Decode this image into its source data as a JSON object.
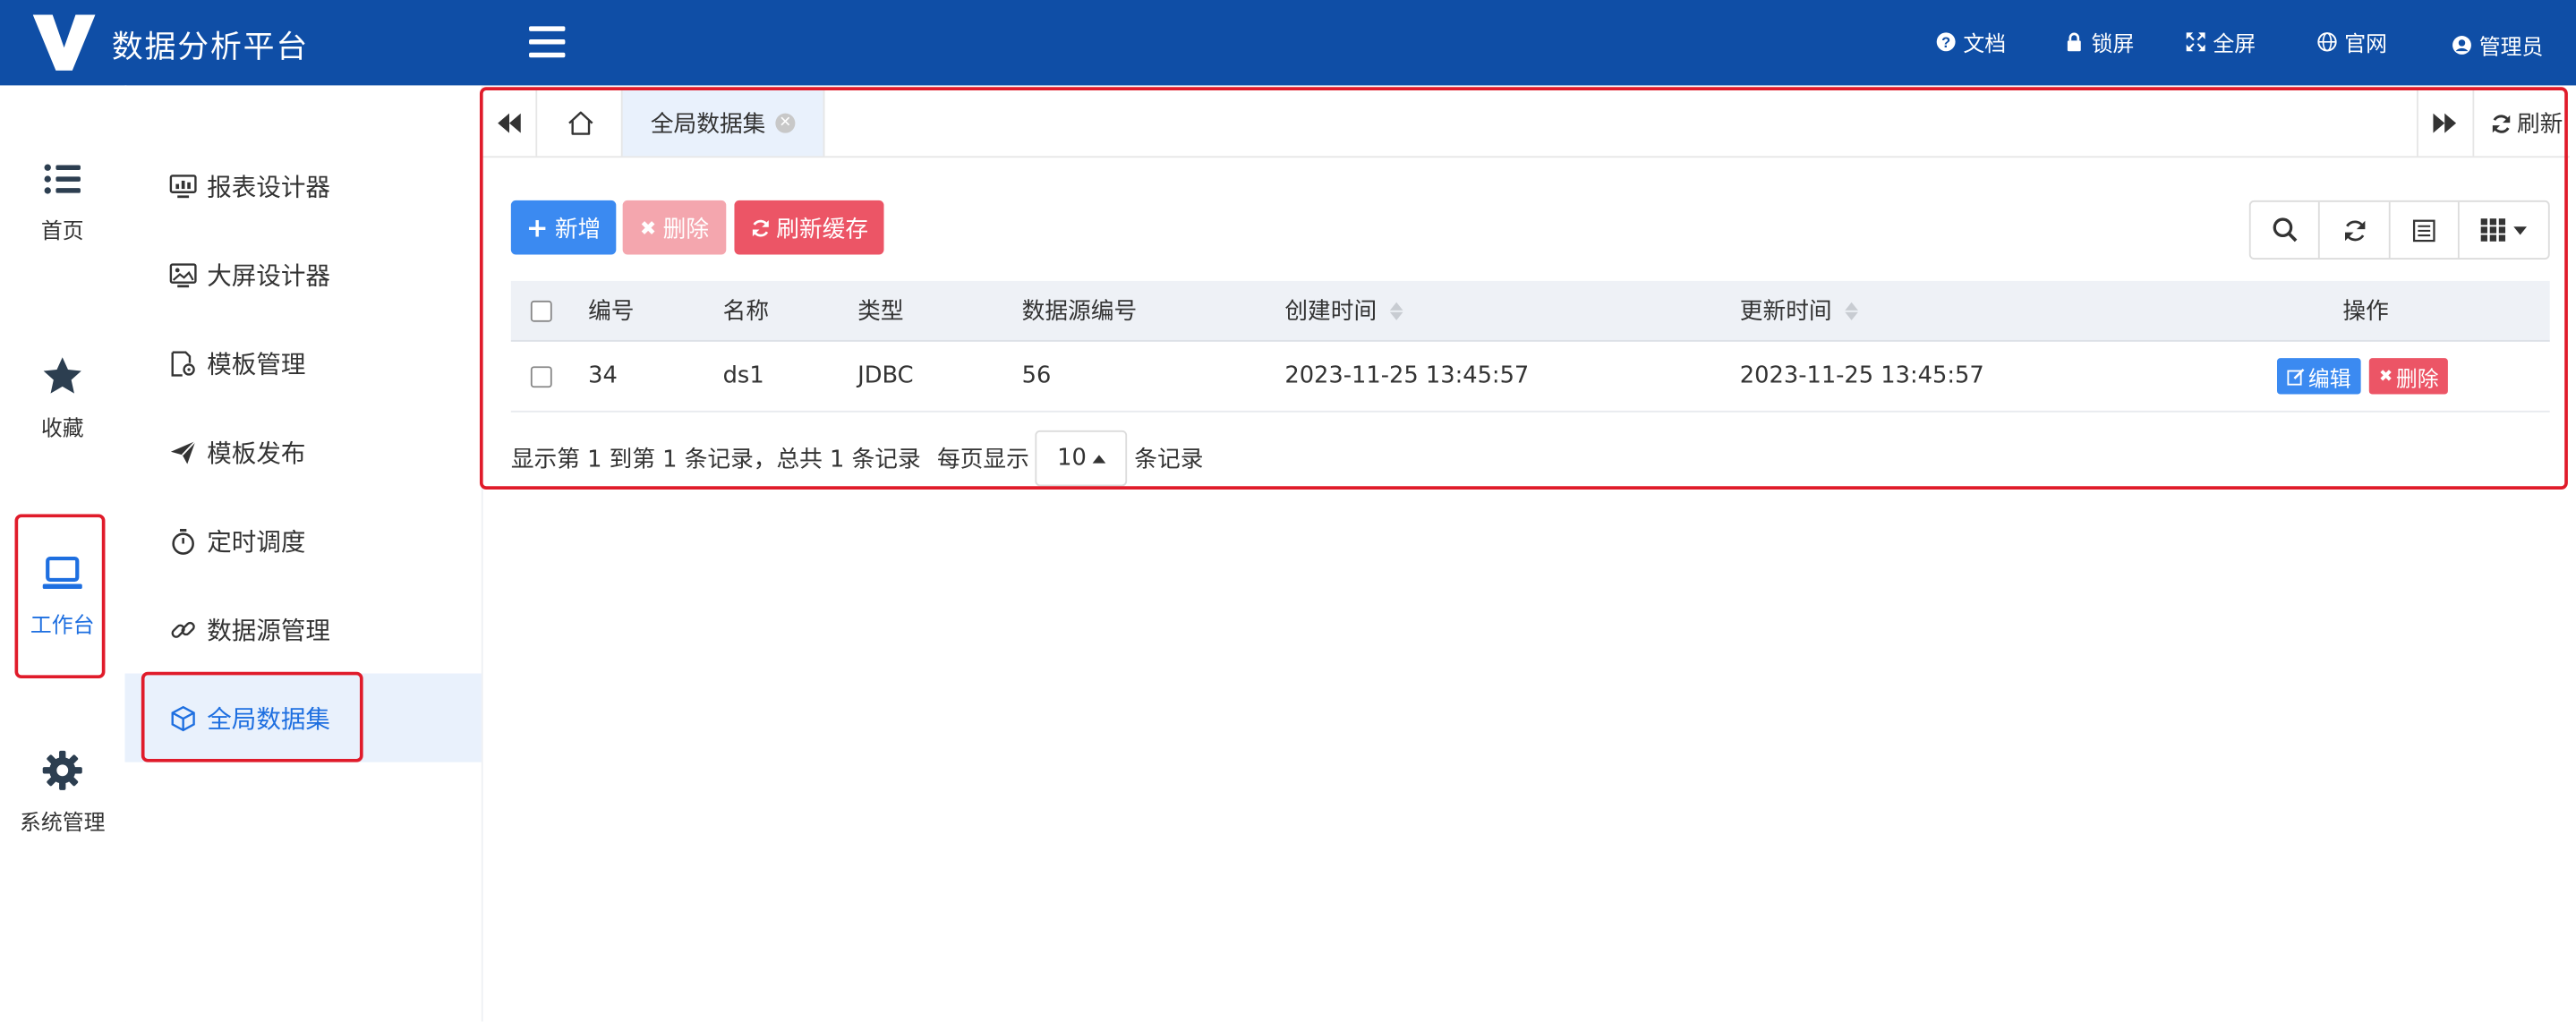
{
  "header": {
    "app_title": "数据分析平台",
    "links": [
      {
        "label": "文档",
        "icon": "question-circle-icon"
      },
      {
        "label": "锁屏",
        "icon": "lock-icon"
      },
      {
        "label": "全屏",
        "icon": "expand-icon"
      },
      {
        "label": "官网",
        "icon": "globe-icon"
      },
      {
        "label": "管理员",
        "icon": "user-circle-icon"
      }
    ],
    "brand_color": "#0f4ea6"
  },
  "rail": {
    "items": [
      {
        "label": "首页",
        "icon": "list-icon"
      },
      {
        "label": "收藏",
        "icon": "star-icon"
      },
      {
        "label": "工作台",
        "icon": "laptop-icon",
        "active": true
      },
      {
        "label": "系统管理",
        "icon": "gear-icon"
      }
    ]
  },
  "submenu": {
    "items": [
      {
        "label": "报表设计器",
        "icon": "monitor-chart-icon"
      },
      {
        "label": "大屏设计器",
        "icon": "screen-image-icon"
      },
      {
        "label": "模板管理",
        "icon": "template-settings-icon"
      },
      {
        "label": "模板发布",
        "icon": "send-icon"
      },
      {
        "label": "定时调度",
        "icon": "stopwatch-icon"
      },
      {
        "label": "数据源管理",
        "icon": "link-icon"
      },
      {
        "label": "全局数据集",
        "icon": "cube-icon",
        "active": true
      }
    ]
  },
  "tabs": {
    "active_label": "全局数据集",
    "refresh_label": "刷新"
  },
  "toolbar": {
    "add_label": "新增",
    "delete_label": "删除",
    "refresh_cache_label": "刷新缓存"
  },
  "table": {
    "columns": [
      "编号",
      "名称",
      "类型",
      "数据源编号",
      "创建时间",
      "更新时间",
      "操作"
    ],
    "rows": [
      {
        "id": "34",
        "name": "ds1",
        "type": "JDBC",
        "datasource_id": "56",
        "created": "2023-11-25 13:45:57",
        "updated": "2023-11-25 13:45:57",
        "edit_label": "编辑",
        "delete_label": "删除"
      }
    ]
  },
  "pagination": {
    "summary": "显示第 1 到第 1 条记录，总共 1 条记录",
    "per_page_prefix": "每页显示",
    "page_size": "10",
    "per_page_suffix": "条记录"
  }
}
